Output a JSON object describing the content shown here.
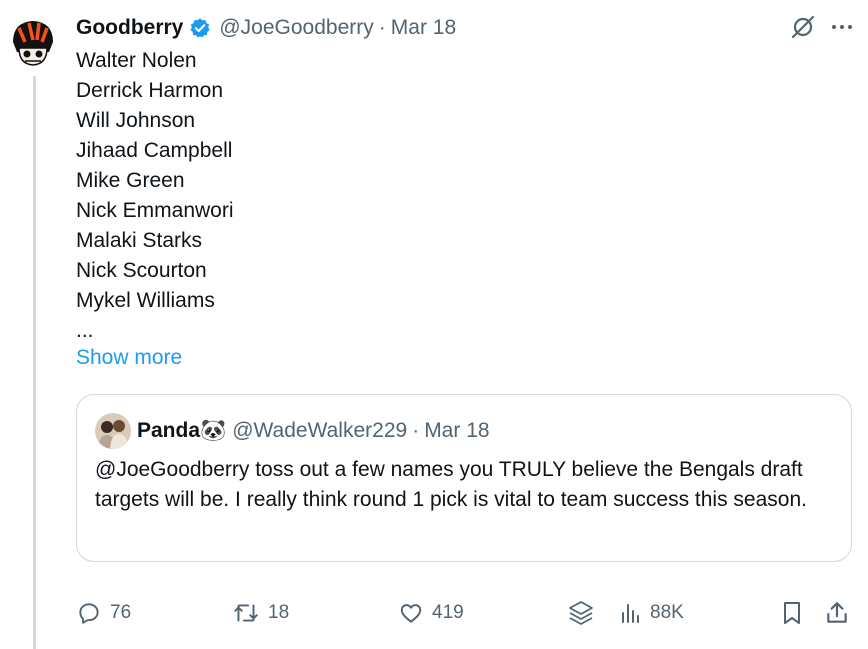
{
  "tweet": {
    "author_name": "Goodberry",
    "handle": "@JoeGoodberry",
    "separator": "·",
    "date": "Mar 18",
    "lines": [
      "Walter Nolen",
      "Derrick Harmon",
      "Will Johnson",
      "Jihaad Campbell",
      "Mike Green",
      "Nick Emmanwori",
      "Malaki Starks",
      "Nick Scourton",
      "Mykel Williams",
      "..."
    ],
    "show_more": "Show more"
  },
  "quote": {
    "author_name": "Panda",
    "emoji": "🐼",
    "handle": "@WadeWalker229",
    "separator": "·",
    "date": "Mar 18",
    "text": "@JoeGoodberry toss out a few names you TRULY believe the Bengals draft targets will be. I really think round 1 pick is vital to team success this season."
  },
  "actions": {
    "replies": "76",
    "reposts": "18",
    "likes": "419",
    "views": "88K"
  },
  "colors": {
    "link": "#1d9bf0",
    "muted": "#536471",
    "border": "#cfd9de",
    "verified": "#1d9bf0",
    "bengals_orange": "#fb4f14"
  },
  "icons": [
    "avatar",
    "verified-badge-icon",
    "grok-icon",
    "more-icon",
    "reply-icon",
    "repost-icon",
    "like-icon",
    "stack-icon",
    "views-icon",
    "bookmark-icon",
    "share-icon"
  ]
}
